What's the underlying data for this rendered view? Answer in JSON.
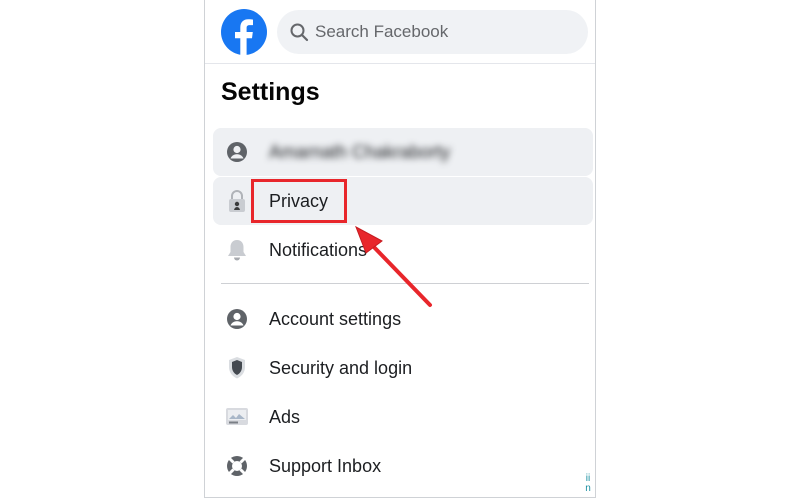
{
  "header": {
    "logo_icon": "facebook-logo-icon",
    "search_placeholder": "Search Facebook"
  },
  "settings": {
    "title": "Settings",
    "profile_name": "Amarnath Chakraborty",
    "top_items": [
      {
        "label": "Privacy",
        "icon": "lock-icon"
      },
      {
        "label": "Notifications",
        "icon": "bell-icon"
      }
    ],
    "items": [
      {
        "label": "Account settings",
        "icon": "account-icon"
      },
      {
        "label": "Security and login",
        "icon": "shield-icon"
      },
      {
        "label": "Ads",
        "icon": "ads-icon"
      },
      {
        "label": "Support Inbox",
        "icon": "lifebuoy-icon"
      }
    ]
  },
  "annotation": {
    "highlight_color": "#e8262b"
  },
  "watermark": {
    "line1": "ii",
    "line2": "n"
  }
}
